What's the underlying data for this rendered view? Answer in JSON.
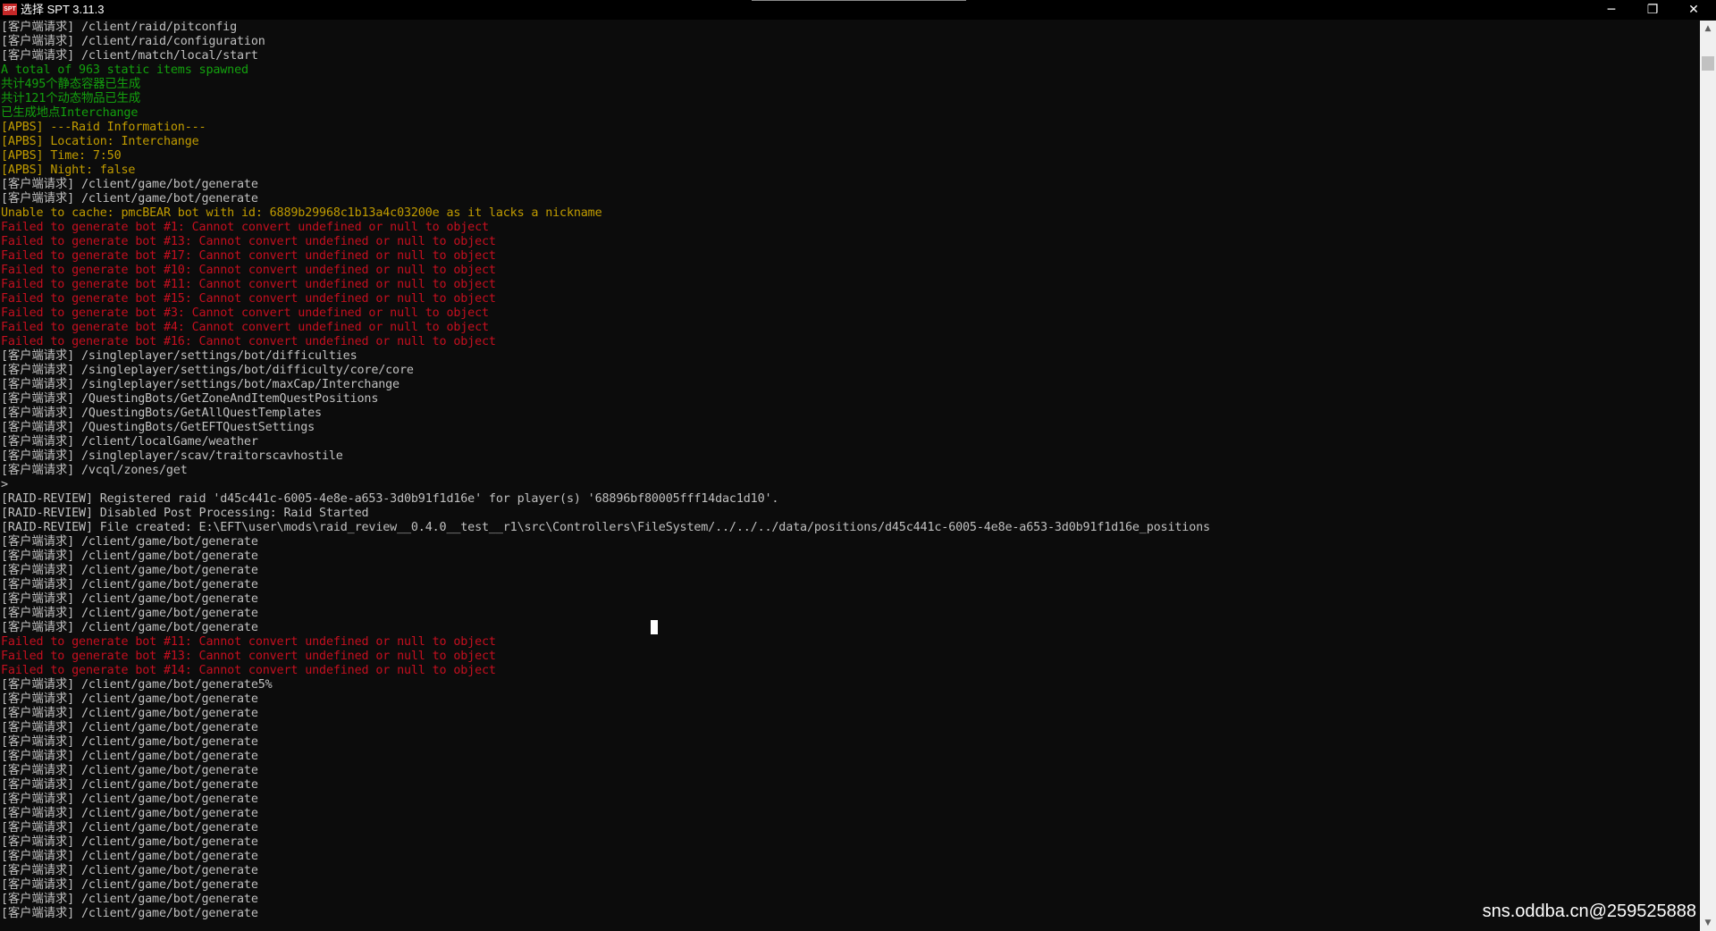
{
  "window": {
    "title": "选择 SPT 3.11.3",
    "icon_text": "SPT",
    "controls": {
      "minimize": "─",
      "maximize": "❐",
      "close": "✕"
    }
  },
  "colors": {
    "background": "#0c0c0c",
    "white": "#c0c0c0",
    "green": "#13a10e",
    "yellow": "#c19c00",
    "red": "#c50f1f"
  },
  "console_lines": [
    {
      "color": "w",
      "text": "[客户端请求] /client/raid/pitconfig"
    },
    {
      "color": "w",
      "text": "[客户端请求] /client/raid/configuration"
    },
    {
      "color": "w",
      "text": "[客户端请求] /client/match/local/start"
    },
    {
      "color": "g",
      "text": "A total of 963 static items spawned"
    },
    {
      "color": "g",
      "text": "共计495个静态容器已生成"
    },
    {
      "color": "g",
      "text": "共计121个动态物品已生成"
    },
    {
      "color": "g",
      "text": "已生成地点Interchange"
    },
    {
      "color": "y",
      "text": "[APBS] ---Raid Information---"
    },
    {
      "color": "y",
      "text": "[APBS] Location: Interchange"
    },
    {
      "color": "y",
      "text": "[APBS] Time: 7:50"
    },
    {
      "color": "y",
      "text": "[APBS] Night: false"
    },
    {
      "color": "w",
      "text": "[客户端请求] /client/game/bot/generate"
    },
    {
      "color": "w",
      "text": "[客户端请求] /client/game/bot/generate"
    },
    {
      "color": "y",
      "text": "Unable to cache: pmcBEAR bot with id: 6889b29968c1b13a4c03200e as it lacks a nickname"
    },
    {
      "color": "r",
      "text": "Failed to generate bot #1: Cannot convert undefined or null to object"
    },
    {
      "color": "r",
      "text": "Failed to generate bot #13: Cannot convert undefined or null to object"
    },
    {
      "color": "r",
      "text": "Failed to generate bot #17: Cannot convert undefined or null to object"
    },
    {
      "color": "r",
      "text": "Failed to generate bot #10: Cannot convert undefined or null to object"
    },
    {
      "color": "r",
      "text": "Failed to generate bot #11: Cannot convert undefined or null to object"
    },
    {
      "color": "r",
      "text": "Failed to generate bot #15: Cannot convert undefined or null to object"
    },
    {
      "color": "r",
      "text": "Failed to generate bot #3: Cannot convert undefined or null to object"
    },
    {
      "color": "r",
      "text": "Failed to generate bot #4: Cannot convert undefined or null to object"
    },
    {
      "color": "r",
      "text": "Failed to generate bot #16: Cannot convert undefined or null to object"
    },
    {
      "color": "w",
      "text": "[客户端请求] /singleplayer/settings/bot/difficulties"
    },
    {
      "color": "w",
      "text": "[客户端请求] /singleplayer/settings/bot/difficulty/core/core"
    },
    {
      "color": "w",
      "text": "[客户端请求] /singleplayer/settings/bot/maxCap/Interchange"
    },
    {
      "color": "w",
      "text": "[客户端请求] /QuestingBots/GetZoneAndItemQuestPositions"
    },
    {
      "color": "w",
      "text": "[客户端请求] /QuestingBots/GetAllQuestTemplates"
    },
    {
      "color": "w",
      "text": "[客户端请求] /QuestingBots/GetEFTQuestSettings"
    },
    {
      "color": "w",
      "text": "[客户端请求] /client/localGame/weather"
    },
    {
      "color": "w",
      "text": "[客户端请求] /singleplayer/scav/traitorscavhostile"
    },
    {
      "color": "w",
      "text": "[客户端请求] /vcql/zones/get"
    },
    {
      "color": "w",
      "text": ">"
    },
    {
      "color": "w",
      "text": "[RAID-REVIEW] Registered raid 'd45c441c-6005-4e8e-a653-3d0b91f1d16e' for player(s) '68896bf80005fff14dac1d10'."
    },
    {
      "color": "w",
      "text": "[RAID-REVIEW] Disabled Post Processing: Raid Started"
    },
    {
      "color": "w",
      "text": "[RAID-REVIEW] File created: E:\\EFT\\user\\mods\\raid_review__0.4.0__test__r1\\src\\Controllers\\FileSystem/../../../data/positions/d45c441c-6005-4e8e-a653-3d0b91f1d16e_positions"
    },
    {
      "color": "w",
      "text": "[客户端请求] /client/game/bot/generate"
    },
    {
      "color": "w",
      "text": "[客户端请求] /client/game/bot/generate"
    },
    {
      "color": "w",
      "text": "[客户端请求] /client/game/bot/generate"
    },
    {
      "color": "w",
      "text": "[客户端请求] /client/game/bot/generate"
    },
    {
      "color": "w",
      "text": "[客户端请求] /client/game/bot/generate"
    },
    {
      "color": "w",
      "text": "[客户端请求] /client/game/bot/generate"
    },
    {
      "color": "w",
      "text": "[客户端请求] /client/game/bot/generate"
    },
    {
      "color": "r",
      "text": "Failed to generate bot #11: Cannot convert undefined or null to object"
    },
    {
      "color": "r",
      "text": "Failed to generate bot #13: Cannot convert undefined or null to object"
    },
    {
      "color": "r",
      "text": "Failed to generate bot #14: Cannot convert undefined or null to object"
    },
    {
      "color": "w",
      "text": "[客户端请求] /client/game/bot/generate5%"
    },
    {
      "color": "w",
      "text": "[客户端请求] /client/game/bot/generate"
    },
    {
      "color": "w",
      "text": "[客户端请求] /client/game/bot/generate"
    },
    {
      "color": "w",
      "text": "[客户端请求] /client/game/bot/generate"
    },
    {
      "color": "w",
      "text": "[客户端请求] /client/game/bot/generate"
    },
    {
      "color": "w",
      "text": "[客户端请求] /client/game/bot/generate"
    },
    {
      "color": "w",
      "text": "[客户端请求] /client/game/bot/generate"
    },
    {
      "color": "w",
      "text": "[客户端请求] /client/game/bot/generate"
    },
    {
      "color": "w",
      "text": "[客户端请求] /client/game/bot/generate"
    },
    {
      "color": "w",
      "text": "[客户端请求] /client/game/bot/generate"
    },
    {
      "color": "w",
      "text": "[客户端请求] /client/game/bot/generate"
    },
    {
      "color": "w",
      "text": "[客户端请求] /client/game/bot/generate"
    },
    {
      "color": "w",
      "text": "[客户端请求] /client/game/bot/generate"
    },
    {
      "color": "w",
      "text": "[客户端请求] /client/game/bot/generate"
    },
    {
      "color": "w",
      "text": "[客户端请求] /client/game/bot/generate"
    },
    {
      "color": "w",
      "text": "[客户端请求] /client/game/bot/generate"
    },
    {
      "color": "w",
      "text": "[客户端请求] /client/game/bot/generate"
    }
  ],
  "scrollbar": {
    "up_arrow": "▲",
    "down_arrow": "▼"
  },
  "watermark": "sns.oddba.cn@259525888"
}
